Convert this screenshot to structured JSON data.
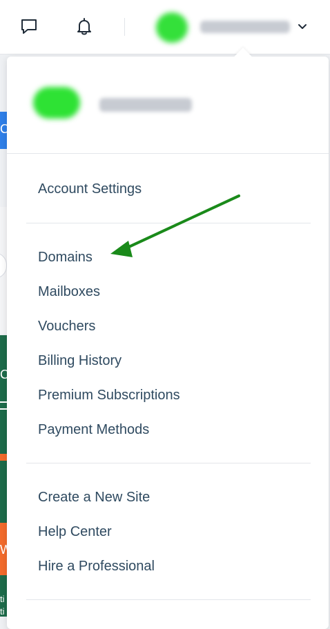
{
  "topbar": {
    "icons": {
      "messages": "chat-bubble-icon",
      "notifications": "bell-icon",
      "dropdown": "chevron-down-icon"
    }
  },
  "menu": {
    "sections": [
      {
        "items": [
          "Account Settings"
        ]
      },
      {
        "items": [
          "Domains",
          "Mailboxes",
          "Vouchers",
          "Billing History",
          "Premium Subscriptions",
          "Payment Methods"
        ]
      },
      {
        "items": [
          "Create a New Site",
          "Help Center",
          "Hire a Professional"
        ]
      }
    ]
  },
  "annotation": {
    "arrow_color": "#1a8a1a",
    "points_to": "Domains"
  },
  "background": {
    "fragments": [
      "C",
      "C",
      "W",
      "ti",
      "ti"
    ]
  },
  "colors": {
    "menu_text": "#2f4a60",
    "blur_avatar": "#34e03a",
    "background_blue": "#2f7fe8",
    "background_green": "#1d6b4a",
    "background_orange": "#f26b2c"
  }
}
